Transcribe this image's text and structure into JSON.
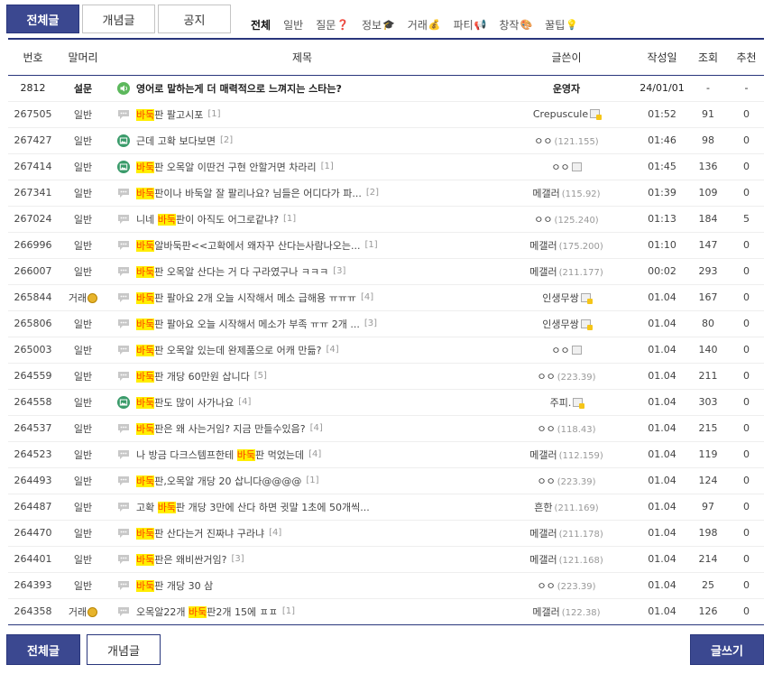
{
  "top_tabs": {
    "all": "전체글",
    "concept": "개념글",
    "notice": "공지"
  },
  "head_tabs": [
    {
      "label": "전체",
      "icon": ""
    },
    {
      "label": "일반",
      "icon": ""
    },
    {
      "label": "질문",
      "icon": "❓"
    },
    {
      "label": "정보",
      "icon": "🎓"
    },
    {
      "label": "거래",
      "icon": "💰"
    },
    {
      "label": "파티",
      "icon": "📢"
    },
    {
      "label": "창작",
      "icon": "🎨"
    },
    {
      "label": "꿀팁",
      "icon": "💡"
    }
  ],
  "columns": {
    "no": "번호",
    "head": "말머리",
    "title": "제목",
    "writer": "글쓴이",
    "date": "작성일",
    "views": "조회",
    "rec": "추천"
  },
  "notice": {
    "no": "2812",
    "head": "설문",
    "title": "영어로 말하는게 더 매력적으로 느껴지는 스타는?",
    "writer": "운영자",
    "date": "24/01/01",
    "views": "-",
    "rec": "-"
  },
  "rows": [
    {
      "no": "267505",
      "head": "일반",
      "icon": "speech",
      "pre": "",
      "hl": "바둑",
      "post": "판 팔고시포",
      "reply": "[1]",
      "writer": "Crepuscule",
      "ip": "",
      "wicon": "fix",
      "date": "01:52",
      "views": "91",
      "rec": "0"
    },
    {
      "no": "267427",
      "head": "일반",
      "icon": "image",
      "pre": "근데 고확 보다보면",
      "hl": "",
      "post": "",
      "reply": "[2]",
      "writer": "ㅇㅇ",
      "ip": "(121.155)",
      "wicon": "",
      "date": "01:46",
      "views": "98",
      "rec": "0"
    },
    {
      "no": "267414",
      "head": "일반",
      "icon": "image",
      "pre": "",
      "hl": "바둑",
      "post": "판 오목알 이딴건 구현 안할거면 차라리",
      "reply": "[1]",
      "writer": "ㅇㅇ",
      "ip": "",
      "wicon": "nik",
      "date": "01:45",
      "views": "136",
      "rec": "0"
    },
    {
      "no": "267341",
      "head": "일반",
      "icon": "speech",
      "pre": "",
      "hl": "바둑",
      "post": "판이나 바둑알 잘 팔리나요? 님들은 어디다가 파...",
      "reply": "[2]",
      "writer": "메갤러",
      "ip": "(115.92)",
      "wicon": "",
      "date": "01:39",
      "views": "109",
      "rec": "0"
    },
    {
      "no": "267024",
      "head": "일반",
      "icon": "speech",
      "pre": "니네 ",
      "hl": "바둑",
      "post": "판이 아직도 어그로같냐?",
      "reply": "[1]",
      "writer": "ㅇㅇ",
      "ip": "(125.240)",
      "wicon": "",
      "date": "01:13",
      "views": "184",
      "rec": "5"
    },
    {
      "no": "266996",
      "head": "일반",
      "icon": "speech",
      "pre": "",
      "hl": "바둑",
      "post": "알바둑판<<고확에서 왜자꾸 산다는사람나오는...",
      "reply": "[1]",
      "writer": "메갤러",
      "ip": "(175.200)",
      "wicon": "",
      "date": "01:10",
      "views": "147",
      "rec": "0"
    },
    {
      "no": "266007",
      "head": "일반",
      "icon": "speech",
      "pre": "",
      "hl": "바둑",
      "post": "판 오목알 산다는 거 다 구라였구나 ㅋㅋㅋ",
      "reply": "[3]",
      "writer": "메갤러",
      "ip": "(211.177)",
      "wicon": "",
      "date": "00:02",
      "views": "293",
      "rec": "0"
    },
    {
      "no": "265844",
      "head": "거래",
      "icon": "speech",
      "pre": "",
      "hl": "바둑",
      "post": "판 팔아요 2개 오늘 시작해서 메소 급해용 ㅠㅠㅠ",
      "reply": "[4]",
      "writer": "인생무쌍",
      "ip": "",
      "wicon": "fix",
      "date": "01.04",
      "views": "167",
      "rec": "0"
    },
    {
      "no": "265806",
      "head": "일반",
      "icon": "speech",
      "pre": "",
      "hl": "바둑",
      "post": "판 팔아요 오늘 시작해서 메소가 부족 ㅠㅠ 2개 ...",
      "reply": "[3]",
      "writer": "인생무쌍",
      "ip": "",
      "wicon": "fix",
      "date": "01.04",
      "views": "80",
      "rec": "0"
    },
    {
      "no": "265003",
      "head": "일반",
      "icon": "speech",
      "pre": "",
      "hl": "바둑",
      "post": "판 오목알 있는데 완제품으로 어캐 만듦?",
      "reply": "[4]",
      "writer": "ㅇㅇ",
      "ip": "",
      "wicon": "nik",
      "date": "01.04",
      "views": "140",
      "rec": "0"
    },
    {
      "no": "264559",
      "head": "일반",
      "icon": "speech",
      "pre": "",
      "hl": "바둑",
      "post": "판 개당 60만원 삽니다",
      "reply": "[5]",
      "writer": "ㅇㅇ",
      "ip": "(223.39)",
      "wicon": "",
      "date": "01.04",
      "views": "211",
      "rec": "0"
    },
    {
      "no": "264558",
      "head": "일반",
      "icon": "image",
      "pre": "",
      "hl": "바둑",
      "post": "판도 많이 사가나요",
      "reply": "[4]",
      "writer": "주피.",
      "ip": "",
      "wicon": "fix",
      "date": "01.04",
      "views": "303",
      "rec": "0"
    },
    {
      "no": "264537",
      "head": "일반",
      "icon": "speech",
      "pre": "",
      "hl": "바둑",
      "post": "판은 왜 사는거임? 지금 만들수있음?",
      "reply": "[4]",
      "writer": "ㅇㅇ",
      "ip": "(118.43)",
      "wicon": "",
      "date": "01.04",
      "views": "215",
      "rec": "0"
    },
    {
      "no": "264523",
      "head": "일반",
      "icon": "speech",
      "pre": "나 방금 다크스템프한테 ",
      "hl": "바둑",
      "post": "판 먹었는데",
      "reply": "[4]",
      "writer": "메갤러",
      "ip": "(112.159)",
      "wicon": "",
      "date": "01.04",
      "views": "119",
      "rec": "0"
    },
    {
      "no": "264493",
      "head": "일반",
      "icon": "speech",
      "pre": "",
      "hl": "바둑",
      "post": "판,오목알 개당 20 삽니다@@@@",
      "reply": "[1]",
      "writer": "ㅇㅇ",
      "ip": "(223.39)",
      "wicon": "",
      "date": "01.04",
      "views": "124",
      "rec": "0"
    },
    {
      "no": "264487",
      "head": "일반",
      "icon": "speech",
      "pre": "고확 ",
      "hl": "바둑",
      "post": "판 개당 3만에 산다 하면 귓말 1초에 50개씩...",
      "reply": "",
      "writer": "흔한",
      "ip": "(211.169)",
      "wicon": "",
      "date": "01.04",
      "views": "97",
      "rec": "0"
    },
    {
      "no": "264470",
      "head": "일반",
      "icon": "speech",
      "pre": "",
      "hl": "바둑",
      "post": "판 산다는거 진짜냐 구라냐",
      "reply": "[4]",
      "writer": "메갤러",
      "ip": "(211.178)",
      "wicon": "",
      "date": "01.04",
      "views": "198",
      "rec": "0"
    },
    {
      "no": "264401",
      "head": "일반",
      "icon": "speech",
      "pre": "",
      "hl": "바둑",
      "post": "판은 왜비싼거임?",
      "reply": "[3]",
      "writer": "메갤러",
      "ip": "(121.168)",
      "wicon": "",
      "date": "01.04",
      "views": "214",
      "rec": "0"
    },
    {
      "no": "264393",
      "head": "일반",
      "icon": "speech",
      "pre": "",
      "hl": "바둑",
      "post": "판 개당 30 삼",
      "reply": "",
      "writer": "ㅇㅇ",
      "ip": "(223.39)",
      "wicon": "",
      "date": "01.04",
      "views": "25",
      "rec": "0"
    },
    {
      "no": "264358",
      "head": "거래",
      "icon": "speech",
      "pre": "오목알22개 ",
      "hl": "바둑",
      "post": "판2개 15에 ㅍㅍ",
      "reply": "[1]",
      "writer": "메갤러",
      "ip": "(122.38)",
      "wicon": "",
      "date": "01.04",
      "views": "126",
      "rec": "0"
    }
  ],
  "bottom": {
    "all": "전체글",
    "concept": "개념글",
    "write": "글쓰기"
  }
}
